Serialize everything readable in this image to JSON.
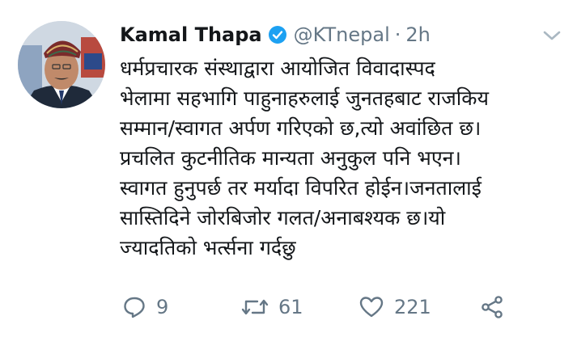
{
  "tweet": {
    "author_name": "Kamal Thapa",
    "handle": "@KTnepal",
    "separator": "·",
    "time": "2h",
    "text_lines": [
      "धर्मप्रचारक संस्थाद्वारा आयोजित विवादास्पद",
      "भेलामा सहभागि पाहुनाहरुलाई जुनतहबाट राजकिय",
      "सम्मान/स्वागत अर्पण गरिएको छ,त्यो अवांछित छ।",
      "प्रचलित कुटनीतिक मान्यता अनुकुल पनि भएन।",
      "स्वागत हुनुपर्छ तर मर्यादा विपरित होईन।जनतालाई",
      "सास्तिदिने जोरबिजोर गलत/अनाबश्यक छ।यो",
      "ज्यादतिको भर्त्सना गर्दछु"
    ],
    "actions": {
      "reply_count": "9",
      "retweet_count": "61",
      "like_count": "221"
    }
  },
  "icons": {
    "avatar": "profile-photo",
    "verified": "verified-badge-icon",
    "caret": "chevron-down-icon",
    "reply": "reply-icon",
    "retweet": "retweet-icon",
    "like": "heart-icon",
    "share": "share-icon"
  },
  "colors": {
    "verified_blue": "#1da1f2",
    "muted_text": "#657786",
    "text": "#14171a"
  }
}
